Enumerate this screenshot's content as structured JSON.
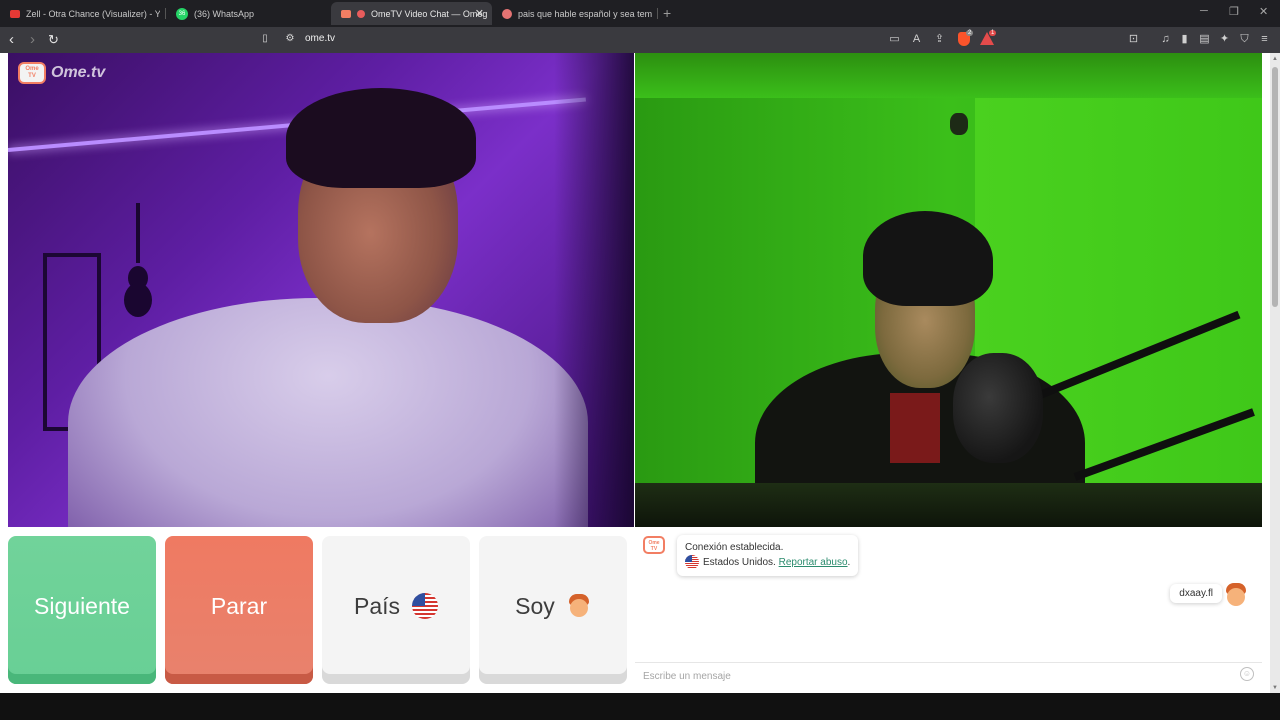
{
  "tabs": [
    {
      "title": "Zell - Otra Chance (Visualizer) - YouT",
      "favicon_color": "#e53935"
    },
    {
      "title": "(36) WhatsApp",
      "favicon_color": "#25d366",
      "badge": "36"
    },
    {
      "title": "OmeTV Video Chat — Omeg",
      "favicon_color": "#f27e63",
      "active": true
    },
    {
      "title": "pais que hable español y sea tempra",
      "favicon_color": "#e57373"
    }
  ],
  "toolbar": {
    "url": "ome.tv",
    "brave_badge": "2",
    "alert_badge": "1"
  },
  "logo": {
    "tv_text": "Ome\nTV",
    "wordmark": "Ome.tv"
  },
  "buttons": {
    "next": "Siguiente",
    "stop": "Parar",
    "country": "País",
    "gender": "Soy"
  },
  "chat": {
    "system_line1": "Conexión establecida.",
    "system_country": "Estados Unidos.",
    "system_report": "Reportar abuso",
    "system_report_suffix": ".",
    "my_message": "dxaay.fl",
    "input_placeholder": "Escribe un mensaje"
  },
  "colors": {
    "next": "#6fd39a",
    "stop": "#ec7b64",
    "brand": "#f27e63",
    "link": "#2c8c6e"
  }
}
